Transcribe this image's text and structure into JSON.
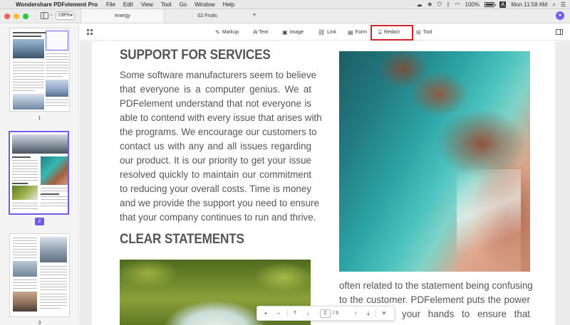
{
  "menubar": {
    "app_name": "Wondershare PDFelement Pro",
    "menus": [
      "File",
      "Edit",
      "View",
      "Tool",
      "Go",
      "Window",
      "Help"
    ],
    "battery": "100%",
    "clock": "Mon 11:58 AM"
  },
  "window": {
    "zoom": "198%",
    "tabs": [
      {
        "label": "energy",
        "active": true
      },
      {
        "label": "02 Fruits",
        "active": false
      }
    ],
    "add_tab": "+"
  },
  "thumbnails": {
    "pages": [
      "1",
      "2",
      "3"
    ],
    "selected": "2",
    "selection_color": "#6e5cf0"
  },
  "toolbar": {
    "items": [
      "Markup",
      "Text",
      "Image",
      "Link",
      "Form",
      "Redact",
      "Tool"
    ],
    "highlighted": "Redact",
    "highlight_color": "#d0232a"
  },
  "document": {
    "heading1": "SUPPORT FOR SERVICES",
    "paragraph1": [
      "Some software manufacturers seem to believe",
      "that everyone is a computer genius. We at",
      "PDFelement understand that not everyone is",
      "able to contend with every issue that arises with",
      "the programs. We encourage our customers to",
      "contact us with any and all issues regarding",
      "our product. It is our priority to get your issue",
      "resolved quickly to maintain our commitment",
      "to reducing your overall costs. Time is money",
      "and we provide the support you need to ensure",
      "that your company continues to run and thrive."
    ],
    "heading2": "CLEAR STATEMENTS",
    "paragraph2": [
      "often related to the statement being confusing",
      "to the customer. PDFelement puts the power",
      "your hands to ensure that"
    ]
  },
  "navigator": {
    "zoom_in": "+",
    "zoom_out": "−",
    "current_page": "2",
    "total_pages": "/ 3",
    "close": "✕"
  }
}
